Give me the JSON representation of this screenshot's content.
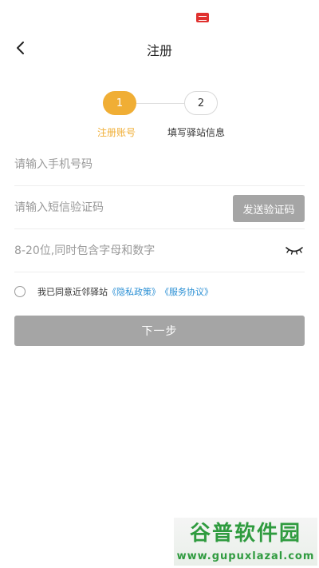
{
  "nav": {
    "title": "注册"
  },
  "steps": [
    {
      "number": "1",
      "label": "注册账号"
    },
    {
      "number": "2",
      "label": "填写驿站信息"
    }
  ],
  "form": {
    "phone_placeholder": "请输入手机号码",
    "code_placeholder": "请输入短信验证码",
    "send_code_label": "发送验证码",
    "password_placeholder": "8-20位,同时包含字母和数字"
  },
  "agreement": {
    "text": "我已同意近邻驿站",
    "privacy_link": "《隐私政策》",
    "service_link": "《服务协议》"
  },
  "next_label": "下一步",
  "watermark": {
    "brand": "谷普软件园",
    "url": "www.gupuxlazal.com"
  },
  "colors": {
    "accent": "#f0ae35",
    "link": "#2a8fd4",
    "disabled_button": "#a5a5a5",
    "watermark": "#2f9b3f"
  }
}
